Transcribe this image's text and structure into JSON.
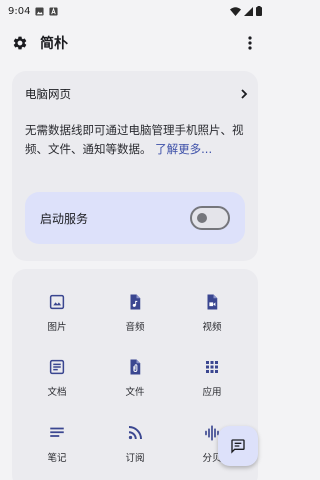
{
  "status_bar": {
    "time": "9:04"
  },
  "app_bar": {
    "title": "简朴"
  },
  "web_card": {
    "title": "电脑网页",
    "description": "无需数据线即可通过电脑管理手机照片、视频、文件、通知等数据。",
    "learn_more": "了解更多..."
  },
  "service": {
    "label": "启动服务",
    "enabled": false
  },
  "grid": {
    "items": [
      {
        "label": "图片",
        "icon": "image-icon"
      },
      {
        "label": "音频",
        "icon": "audio-file-icon"
      },
      {
        "label": "视频",
        "icon": "video-file-icon"
      },
      {
        "label": "文档",
        "icon": "document-icon"
      },
      {
        "label": "文件",
        "icon": "attachment-file-icon"
      },
      {
        "label": "应用",
        "icon": "apps-icon"
      },
      {
        "label": "笔记",
        "icon": "notes-icon"
      },
      {
        "label": "订阅",
        "icon": "rss-icon"
      },
      {
        "label": "分贝",
        "icon": "sound-wave-icon"
      }
    ]
  },
  "colors": {
    "accent": "#3c4fa8",
    "icon": "#3a4690",
    "service_bg": "#dde1fa",
    "card_bg": "#ebebef"
  }
}
